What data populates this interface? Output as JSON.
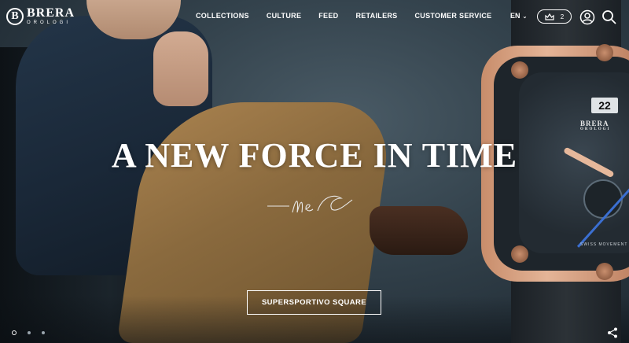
{
  "brand": {
    "mark": "B",
    "name": "BRERA",
    "sub": "OROLOGI"
  },
  "nav": {
    "items": [
      {
        "label": "COLLECTIONS"
      },
      {
        "label": "CULTURE"
      },
      {
        "label": "FEED"
      },
      {
        "label": "RETAILERS"
      },
      {
        "label": "CUSTOMER SERVICE"
      }
    ]
  },
  "header": {
    "language": "EN",
    "cart_count": "2",
    "icons": [
      "crown-cart-icon",
      "user-icon",
      "search-icon"
    ]
  },
  "hero": {
    "headline": "A NEW FORCE IN TIME",
    "cta_label": "SUPERSPORTIVO SQUARE",
    "slides": 3,
    "active_slide": 1
  },
  "watch": {
    "date": "22",
    "brand": "BRERA",
    "brand_sub": "OROLOGI",
    "movement": "SWISS MOVEMENT"
  },
  "colors": {
    "text": "#ffffff",
    "accent_gold": "#e4b497",
    "hand_blue": "#3b6fd1"
  }
}
